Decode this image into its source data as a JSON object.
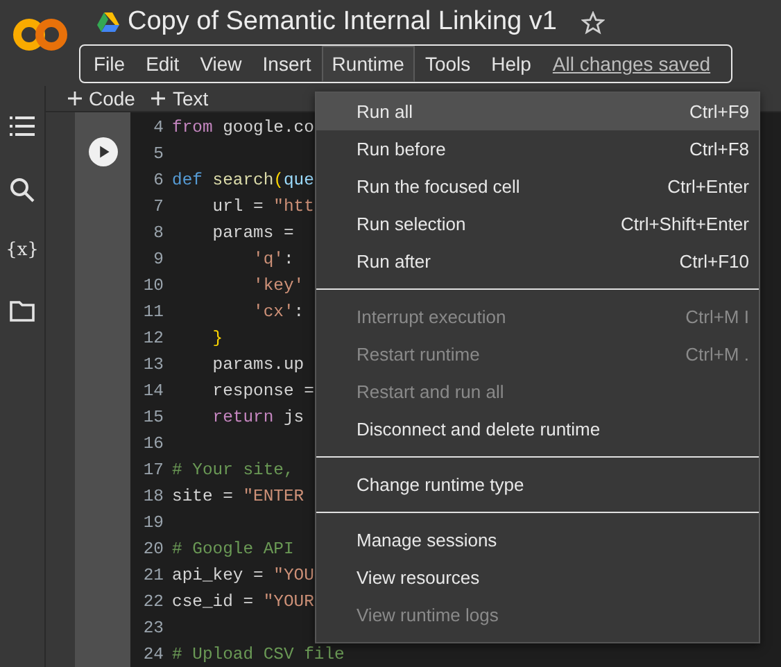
{
  "header": {
    "title": "Copy of Semantic Internal Linking v1",
    "starred": false
  },
  "menubar": {
    "items": [
      {
        "label": "File",
        "selected": false
      },
      {
        "label": "Edit",
        "selected": false
      },
      {
        "label": "View",
        "selected": false
      },
      {
        "label": "Insert",
        "selected": false
      },
      {
        "label": "Runtime",
        "selected": true
      },
      {
        "label": "Tools",
        "selected": false
      },
      {
        "label": "Help",
        "selected": false
      }
    ],
    "status": "All changes saved"
  },
  "sidebar": {
    "variables_label": "{x}"
  },
  "toolbar": {
    "buttons": [
      "Code",
      "Text"
    ]
  },
  "code": {
    "lines": [
      {
        "number": "4",
        "tokens": [
          {
            "kind": "keyword",
            "text": "from"
          },
          {
            "kind": "plain",
            "text": " google.co"
          }
        ]
      },
      {
        "number": "5"
      },
      {
        "number": "6",
        "tokens": [
          {
            "kind": "def",
            "text": "def "
          },
          {
            "kind": "func",
            "text": "search"
          },
          {
            "kind": "paren",
            "text": "("
          },
          {
            "kind": "param",
            "text": "que"
          }
        ]
      },
      {
        "number": "7",
        "tokens": [
          {
            "kind": "plain",
            "text": "    url = "
          },
          {
            "kind": "string",
            "text": "\"htt"
          }
        ]
      },
      {
        "number": "8",
        "tokens": [
          {
            "kind": "plain",
            "text": "    params = "
          }
        ]
      },
      {
        "number": "9",
        "tokens": [
          {
            "kind": "string",
            "text": "        'q'"
          },
          {
            "kind": "plain",
            "text": ":"
          }
        ]
      },
      {
        "number": "10",
        "tokens": [
          {
            "kind": "string",
            "text": "        'key'"
          }
        ]
      },
      {
        "number": "11",
        "tokens": [
          {
            "kind": "string",
            "text": "        'cx'"
          },
          {
            "kind": "plain",
            "text": ":"
          }
        ]
      },
      {
        "number": "12",
        "tokens": [
          {
            "kind": "paren",
            "text": "    }"
          }
        ]
      },
      {
        "number": "13",
        "tokens": [
          {
            "kind": "plain",
            "text": "    params.up"
          }
        ]
      },
      {
        "number": "14",
        "tokens": [
          {
            "kind": "plain",
            "text": "    response ="
          }
        ]
      },
      {
        "number": "15",
        "tokens": [
          {
            "kind": "keyword",
            "text": "    return"
          },
          {
            "kind": "plain",
            "text": " js"
          }
        ]
      },
      {
        "number": "16"
      },
      {
        "number": "17",
        "tokens": [
          {
            "kind": "comment",
            "text": "# Your site, "
          }
        ]
      },
      {
        "number": "18",
        "tokens": [
          {
            "kind": "plain",
            "text": "site = "
          },
          {
            "kind": "string",
            "text": "\"ENTER"
          }
        ]
      },
      {
        "number": "19"
      },
      {
        "number": "20",
        "tokens": [
          {
            "kind": "comment",
            "text": "# Google API "
          }
        ]
      },
      {
        "number": "21",
        "tokens": [
          {
            "kind": "plain",
            "text": "api_key = "
          },
          {
            "kind": "string",
            "text": "\"YOU"
          }
        ]
      },
      {
        "number": "22",
        "tokens": [
          {
            "kind": "plain",
            "text": "cse_id = "
          },
          {
            "kind": "string",
            "text": "\"YOUR"
          }
        ]
      },
      {
        "number": "23"
      },
      {
        "number": "24",
        "tokens": [
          {
            "kind": "comment",
            "text": "# Upload CSV file"
          }
        ]
      }
    ]
  },
  "menu": {
    "sections": [
      [
        {
          "label": "Run all",
          "shortcut": "Ctrl+F9",
          "disabled": false,
          "selected": true
        },
        {
          "label": "Run before",
          "shortcut": "Ctrl+F8",
          "disabled": false,
          "selected": false
        },
        {
          "label": "Run the focused cell",
          "shortcut": "Ctrl+Enter",
          "disabled": false,
          "selected": false
        },
        {
          "label": "Run selection",
          "shortcut": "Ctrl+Shift+Enter",
          "disabled": false,
          "selected": false
        },
        {
          "label": "Run after",
          "shortcut": "Ctrl+F10",
          "disabled": false,
          "selected": false
        }
      ],
      [
        {
          "label": "Interrupt execution",
          "shortcut": "Ctrl+M I",
          "disabled": true,
          "selected": false
        },
        {
          "label": "Restart runtime",
          "shortcut": "Ctrl+M .",
          "disabled": true,
          "selected": false
        },
        {
          "label": "Restart and run all",
          "disabled": true,
          "selected": false
        },
        {
          "label": "Disconnect and delete runtime",
          "disabled": false,
          "selected": false
        }
      ],
      [
        {
          "label": "Change runtime type",
          "disabled": false,
          "selected": false
        }
      ],
      [
        {
          "label": "Manage sessions",
          "disabled": false,
          "selected": false
        },
        {
          "label": "View resources",
          "disabled": false,
          "selected": false
        },
        {
          "label": "View runtime logs",
          "disabled": true,
          "selected": false
        }
      ]
    ]
  }
}
